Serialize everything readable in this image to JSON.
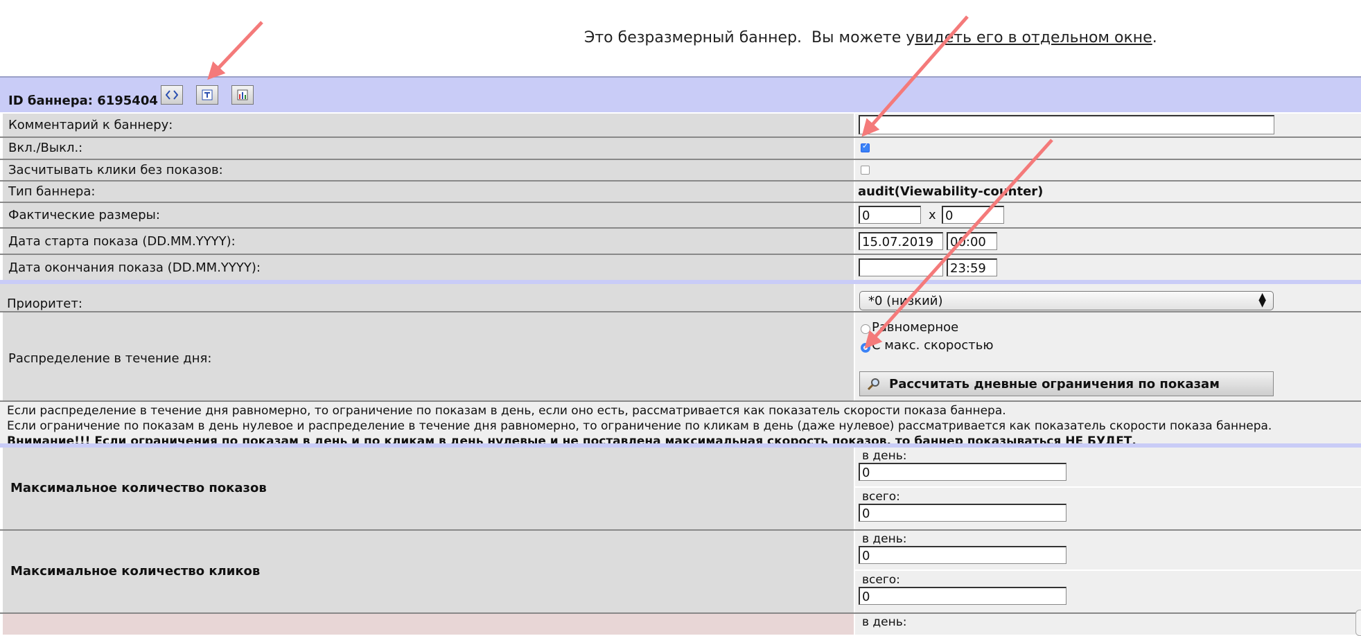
{
  "top_notice": {
    "text_before": "Это безразмерный баннер.  Вы можете у",
    "link_text": "видеть его в отдельном окне",
    "text_after": "."
  },
  "header": {
    "id_label": "ID баннера: 6195404",
    "icons": [
      "code-icon",
      "text-icon",
      "bar-chart-icon"
    ]
  },
  "fields": {
    "comment": {
      "label": "Комментарий к баннеру:",
      "value": ""
    },
    "onoff": {
      "label": "Вкл./Выкл.:",
      "checked": true
    },
    "clicks_wo_shows": {
      "label": "Засчитывать клики без показов:",
      "checked": false
    },
    "banner_type": {
      "label": "Тип баннера:",
      "value": "audit(Viewability-counter)"
    },
    "sizes": {
      "label": "Фактические размеры:",
      "width": "0",
      "separator": "x",
      "height": "0"
    },
    "start": {
      "label": "Дата старта показа (DD.MM.YYYY):",
      "date": "15.07.2019",
      "time": "00:00"
    },
    "end": {
      "label": "Дата окончания показа (DD.MM.YYYY):",
      "date": "",
      "time": "23:59"
    },
    "priority": {
      "label": "Приоритет:",
      "selected": "*0 (низкий)"
    },
    "distribution": {
      "label": "Распределение в течение дня:",
      "options": [
        "Равномерное",
        "С макс. скоростью"
      ],
      "selected_index": 1,
      "calc_button": "Рассчитать дневные ограничения по показам"
    }
  },
  "info": {
    "line1": "Если распределение в течение дня равномерно, то ограничение по показам в день, если оно есть, рассматривается как показатель скорости показа баннера.",
    "line2": "Если ограничение по показам в день нулевое и распределение в течение дня равномерно, то ограничение по кликам в день (даже нулевое) рассматривается как показатель скорости показа баннера.",
    "warning": "Внимание!!! Если ограничения по показам в день и по кликам в день нулевые и не поставлена максимальная скорость показов, то баннер показываться НЕ БУДЕТ."
  },
  "limits": {
    "shows": {
      "label": "Максимальное количество показов",
      "per_day_label": "в день:",
      "per_day": "0",
      "total_label": "всего:",
      "total": "0"
    },
    "clicks": {
      "label": "Максимальное количество кликов",
      "per_day_label": "в день:",
      "per_day": "0",
      "total_label": "всего:",
      "total": "0"
    },
    "next_partial_label": "в день:"
  },
  "colors": {
    "header_bg": "#c9ccf7",
    "label_bg": "#dcdcdc",
    "value_bg": "#efefef",
    "accent": "#3b82f6",
    "arrow": "#f47a7a"
  }
}
